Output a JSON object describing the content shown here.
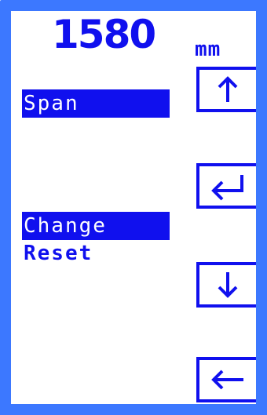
{
  "display": {
    "value": "1580",
    "unit": "mm"
  },
  "menu": {
    "items": [
      {
        "label": "Span",
        "selected": true
      },
      {
        "label": "Change",
        "selected": true
      },
      {
        "label": "Reset",
        "selected": false
      }
    ]
  },
  "buttons": [
    {
      "icon": "arrow-up-icon"
    },
    {
      "icon": "enter-icon"
    },
    {
      "icon": "arrow-down-icon"
    },
    {
      "icon": "arrow-left-icon"
    }
  ],
  "colors": {
    "frame": "#3c78ff",
    "accent": "#1010ee",
    "background": "#ffffff"
  }
}
